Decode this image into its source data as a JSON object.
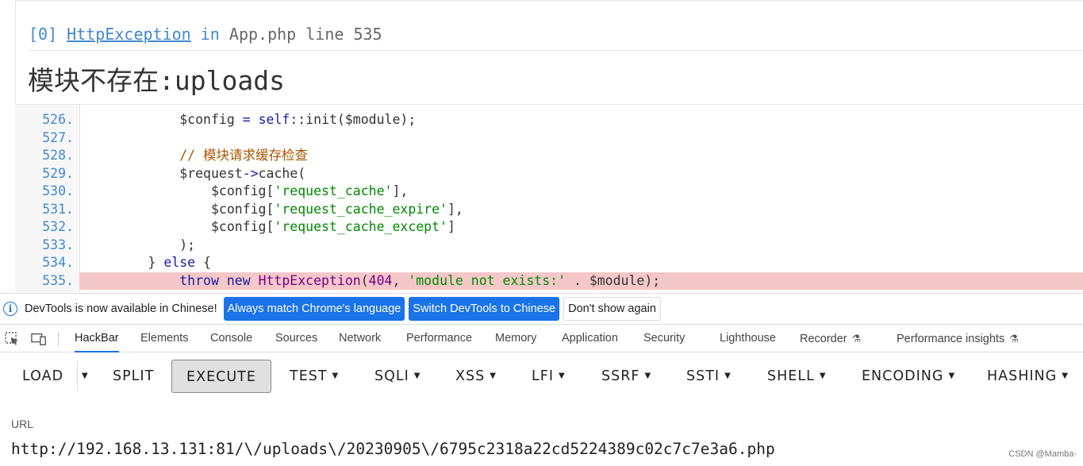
{
  "exception": {
    "index": "[0]",
    "class": "HttpException",
    "in": "in",
    "file": "App.php",
    "line_label": "line",
    "line": "535",
    "message": "模块不存在:uploads"
  },
  "source": {
    "lines": [
      {
        "num": "526.",
        "parts": [
          [
            "var",
            "$config "
          ],
          [
            "kw",
            "="
          ],
          [
            "var",
            " "
          ],
          [
            "kw",
            "self"
          ],
          [
            "var",
            "::init($module);"
          ]
        ],
        "indent": "            "
      },
      {
        "num": "527.",
        "parts": [],
        "indent": ""
      },
      {
        "num": "528.",
        "parts": [
          [
            "cm",
            "// 模块请求缓存检查"
          ]
        ],
        "indent": "            "
      },
      {
        "num": "529.",
        "parts": [
          [
            "var",
            "$request"
          ],
          [
            "kw",
            "->"
          ],
          [
            "var",
            "cache("
          ]
        ],
        "indent": "            "
      },
      {
        "num": "530.",
        "parts": [
          [
            "var",
            "$config["
          ],
          [
            "str",
            "'request_cache'"
          ],
          [
            "var",
            "],"
          ]
        ],
        "indent": "                "
      },
      {
        "num": "531.",
        "parts": [
          [
            "var",
            "$config["
          ],
          [
            "str",
            "'request_cache_expire'"
          ],
          [
            "var",
            "],"
          ]
        ],
        "indent": "                "
      },
      {
        "num": "532.",
        "parts": [
          [
            "var",
            "$config["
          ],
          [
            "str",
            "'request_cache_except'"
          ],
          [
            "var",
            "]"
          ]
        ],
        "indent": "                "
      },
      {
        "num": "533.",
        "parts": [
          [
            "var",
            ");"
          ]
        ],
        "indent": "            "
      },
      {
        "num": "534.",
        "parts": [
          [
            "var",
            "} "
          ],
          [
            "kw",
            "else"
          ],
          [
            "var",
            " {"
          ]
        ],
        "indent": "        "
      },
      {
        "num": "535.",
        "parts": [
          [
            "kw",
            "throw new "
          ],
          [
            "cn",
            "HttpException"
          ],
          [
            "var",
            "("
          ],
          [
            "cn",
            "404"
          ],
          [
            "var",
            ", "
          ],
          [
            "str",
            "'module not exists:'"
          ],
          [
            "var",
            " . $module);"
          ]
        ],
        "indent": "            ",
        "highlight": true
      }
    ]
  },
  "infobar": {
    "text": "DevTools is now available in Chinese!",
    "btn_match": "Always match Chrome's language",
    "btn_switch": "Switch DevTools to Chinese",
    "btn_dismiss": "Don't show again"
  },
  "tabs": [
    "HackBar",
    "Elements",
    "Console",
    "Sources",
    "Network",
    "Performance",
    "Memory",
    "Application",
    "Security",
    "Lighthouse",
    "Recorder",
    "Performance insights"
  ],
  "active_tab": "HackBar",
  "hackbar": {
    "buttons": [
      "LOAD",
      "SPLIT",
      "EXECUTE",
      "TEST",
      "SQLI",
      "XSS",
      "LFI",
      "SSRF",
      "SSTI",
      "SHELL",
      "ENCODING",
      "HASHING"
    ],
    "url_label": "URL",
    "url_value": "http://192.168.13.131:81/\\/uploads\\/20230905\\/6795c2318a22cd5224389c02c7c7e3a6.php"
  },
  "watermark": "CSDN @Mamba-"
}
